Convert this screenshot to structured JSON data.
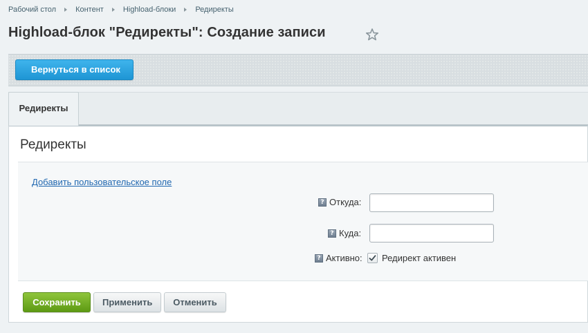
{
  "breadcrumb": [
    "Рабочий стол",
    "Контент",
    "Highload-блоки",
    "Редиректы"
  ],
  "page": {
    "title": "Highload-блок \"Редиректы\": Создание записи"
  },
  "toolbar": {
    "back_label": "Вернуться в список"
  },
  "tabs": [
    {
      "label": "Редиректы"
    }
  ],
  "section": {
    "title": "Редиректы"
  },
  "form": {
    "add_field_link": "Добавить пользовательское поле",
    "fields": {
      "from": {
        "label": "Откуда:",
        "value": "",
        "placeholder": ""
      },
      "to": {
        "label": "Куда:",
        "value": "",
        "placeholder": ""
      },
      "active": {
        "label": "Активно:",
        "checkbox_label": "Редирект активен",
        "checked": true
      }
    },
    "help_icon_glyph": "?"
  },
  "buttons": {
    "save": "Сохранить",
    "apply": "Применить",
    "cancel": "Отменить"
  },
  "colors": {
    "accent_blue": "#1e95d4",
    "save_green": "#5d9a13",
    "link": "#2067b0"
  }
}
